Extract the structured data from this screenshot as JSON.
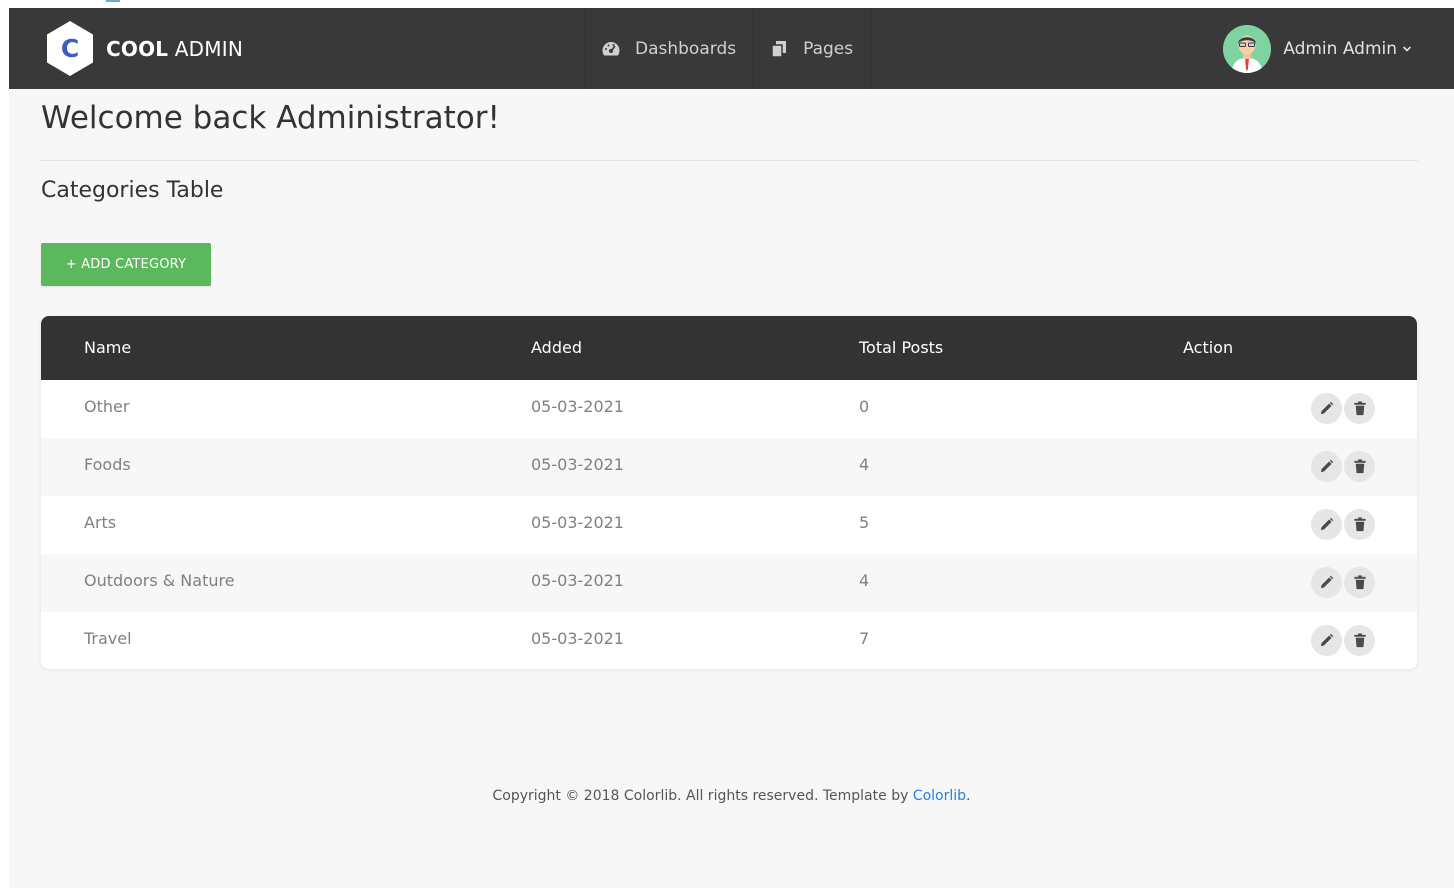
{
  "brand": {
    "logo_letter": "C",
    "name_bold": "COOL",
    "name_light": "ADMIN"
  },
  "nav": {
    "items": [
      {
        "label": "Dashboards",
        "icon": "tachometer-icon"
      },
      {
        "label": "Pages",
        "icon": "copy-pages-icon"
      }
    ]
  },
  "account": {
    "name": "Admin Admin"
  },
  "page": {
    "title": "Welcome back Administrator!",
    "section_title": "Categories Table",
    "add_button": "+ ADD CATEGORY"
  },
  "table": {
    "headers": {
      "name": "Name",
      "added": "Added",
      "posts": "Total Posts",
      "action": "Action"
    },
    "rows": [
      {
        "name": "Other",
        "added": "05-03-2021",
        "posts": "0"
      },
      {
        "name": "Foods",
        "added": "05-03-2021",
        "posts": "4"
      },
      {
        "name": "Arts",
        "added": "05-03-2021",
        "posts": "5"
      },
      {
        "name": "Outdoors & Nature",
        "added": "05-03-2021",
        "posts": "4"
      },
      {
        "name": "Travel",
        "added": "05-03-2021",
        "posts": "7"
      }
    ]
  },
  "footer": {
    "text": "Copyright © 2018 Colorlib. All rights reserved. Template by ",
    "link": "Colorlib",
    "suffix": "."
  },
  "colors": {
    "header_bg": "#393939",
    "table_header_bg": "#333333",
    "add_button": "#5cb85c",
    "link": "#1f83e0",
    "logo_blue": "#3e5dbf"
  }
}
